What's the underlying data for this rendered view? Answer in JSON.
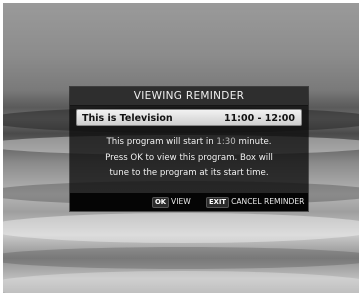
{
  "dialog": {
    "title": "VIEWING REMINDER",
    "program_title": "This is Television",
    "program_time": "11:00 - 12:00",
    "message_line1_prefix": "This program will start in ",
    "message_line1_value": "1:30",
    "message_line1_suffix": " minute.",
    "message_line2": "Press OK to view this program. Box will",
    "message_line3": "tune to the program at its start time."
  },
  "footer": {
    "ok_key": "OK",
    "ok_label": "VIEW",
    "exit_key": "EXIT",
    "exit_label": "CANCEL REMINDER"
  },
  "colors": {
    "dialog_bg": "#0c0c0c",
    "header_bg": "#2e2e2e",
    "program_bar_bg": "#e6e6e6",
    "highlight_text": "#bfbfbf"
  }
}
